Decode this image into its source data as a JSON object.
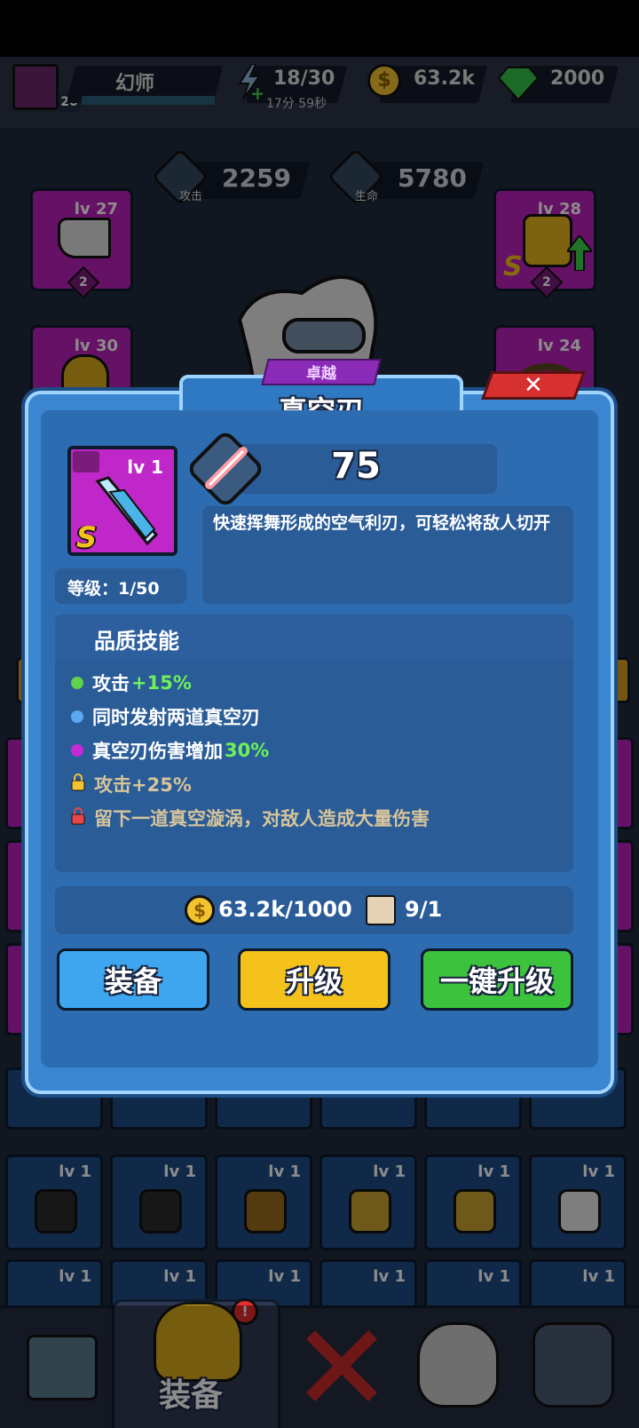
{
  "topbar": {
    "player_name": "幻师",
    "player_level": "20",
    "energy": "18/30",
    "energy_timer": "17分 59秒",
    "coins": "63.2k",
    "gems": "2000"
  },
  "stats": {
    "attack_value": "2259",
    "attack_label": "攻击",
    "hp_value": "5780",
    "hp_label": "生命"
  },
  "equipment_slots": {
    "weapon_lv": "lv 27",
    "weapon_badge": "2",
    "armor_lv": "lv 28",
    "armor_badge": "2",
    "helmet_lv": "lv 30",
    "ring_lv": "lv 24",
    "grade_letter": "S"
  },
  "inventory_grid": {
    "row1_labels": [
      "lv 1",
      "lv 1",
      "lv 1",
      "lv 1",
      "lv 1",
      "lv 1"
    ],
    "row2_labels": [
      "lv 1",
      "lv 1",
      "lv 1",
      "lv 1",
      "lv 1",
      "lv 1"
    ]
  },
  "dialog": {
    "rarity": "卓越",
    "title": "真空刃",
    "item_level": "lv 1",
    "grade": "S",
    "power": "75",
    "description": "快速挥舞形成的空气利刃，可轻松将敌人切开",
    "level_text": "等级：1/50",
    "skills_header": "品质技能",
    "skills": [
      {
        "label": "攻击",
        "bonus": "+15%",
        "color": "#5fd34a",
        "locked": false
      },
      {
        "label": "同时发射两道真空刃",
        "bonus": "",
        "color": "#5aa8f0",
        "locked": false
      },
      {
        "label": "真空刃伤害增加",
        "bonus": "30%",
        "color": "#c42bd6",
        "locked": false
      },
      {
        "label": "攻击+25%",
        "bonus": "",
        "color": "#f2c230",
        "locked": true
      },
      {
        "label": "留下一道真空漩涡，对敌人造成大量伤害",
        "bonus": "",
        "color": "#e84646",
        "locked": true
      }
    ],
    "cost_coins": "63.2k/1000",
    "cost_material": "9/1",
    "equip_button": "装备",
    "upgrade_button": "升级",
    "one_click_button": "一键升级"
  },
  "bottom_nav": {
    "active_tab": "装备"
  },
  "colors": {
    "accent_purple": "#b81fb8",
    "green_button": "#3cc23c",
    "yellow_button": "#f5c21b",
    "blue_button": "#3da6ee"
  }
}
